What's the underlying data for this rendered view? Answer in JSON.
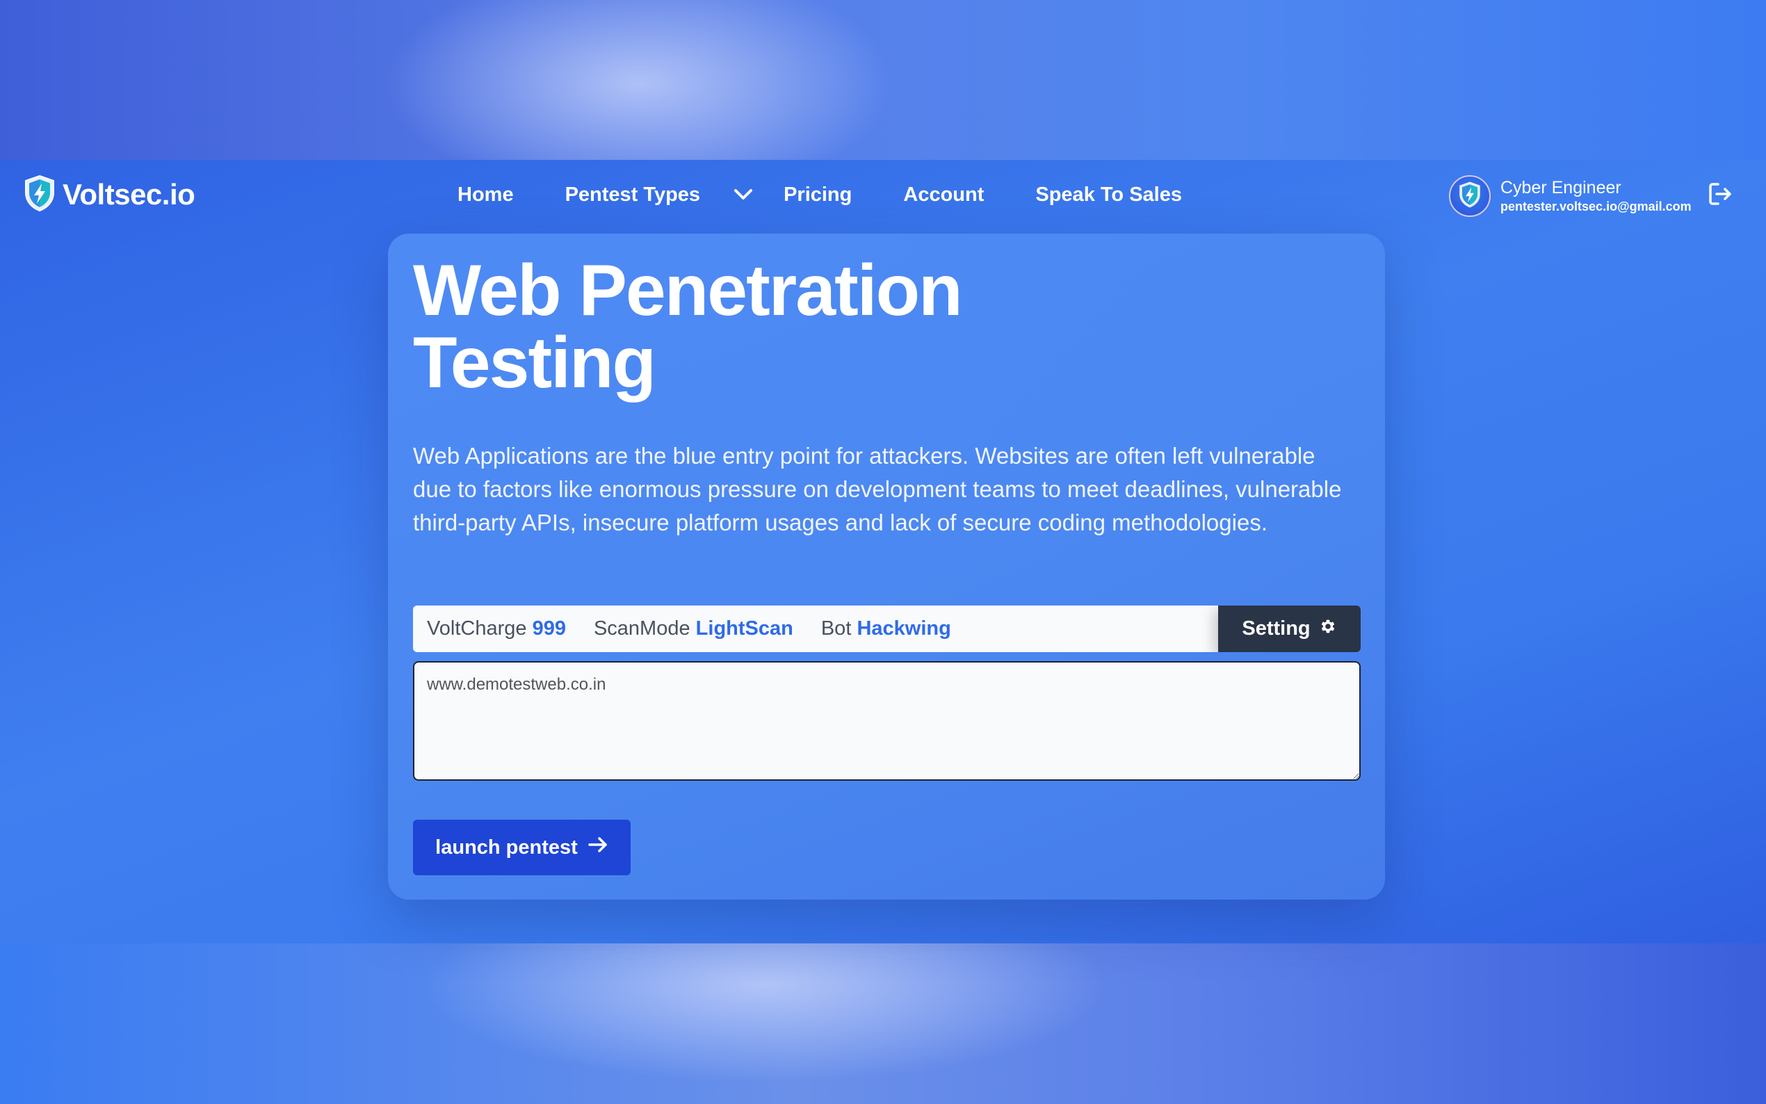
{
  "brand": {
    "name": "Voltsec.io",
    "logo_icon": "shield-bolt-icon"
  },
  "nav": {
    "items": [
      {
        "label": "Home"
      },
      {
        "label": "Pentest Types"
      },
      {
        "label": "Pricing"
      },
      {
        "label": "Account"
      },
      {
        "label": "Speak To Sales"
      }
    ],
    "dropdown_icon": "chevron-down-icon"
  },
  "user": {
    "name": "Cyber Engineer",
    "email": "pentester.voltsec.io@gmail.com",
    "avatar_icon": "shield-bolt-icon",
    "logout_icon": "logout-icon"
  },
  "hero": {
    "title_line1": "Web Penetration",
    "title_line2": "Testing",
    "description": "Web Applications are the blue entry point for attackers. Websites are often left vulnerable due to factors like enormous pressure on development teams to meet deadlines, vulnerable third-party APIs, insecure platform usages and lack of secure coding methodologies."
  },
  "status": {
    "voltcharge_label": "VoltCharge",
    "voltcharge_value": "999",
    "scanmode_label": "ScanMode",
    "scanmode_value": "LightScan",
    "bot_label": "Bot",
    "bot_value": "Hackwing",
    "setting_label": "Setting",
    "setting_icon": "gear-icon"
  },
  "target_input": {
    "placeholder": "www.demotestweb.co.in",
    "value": ""
  },
  "launch": {
    "label": "launch pentest",
    "icon": "arrow-right-icon"
  },
  "colors": {
    "accent_value": "#2f6be8",
    "setting_bg": "#2a3447",
    "launch_bg": "#1e45d6"
  }
}
